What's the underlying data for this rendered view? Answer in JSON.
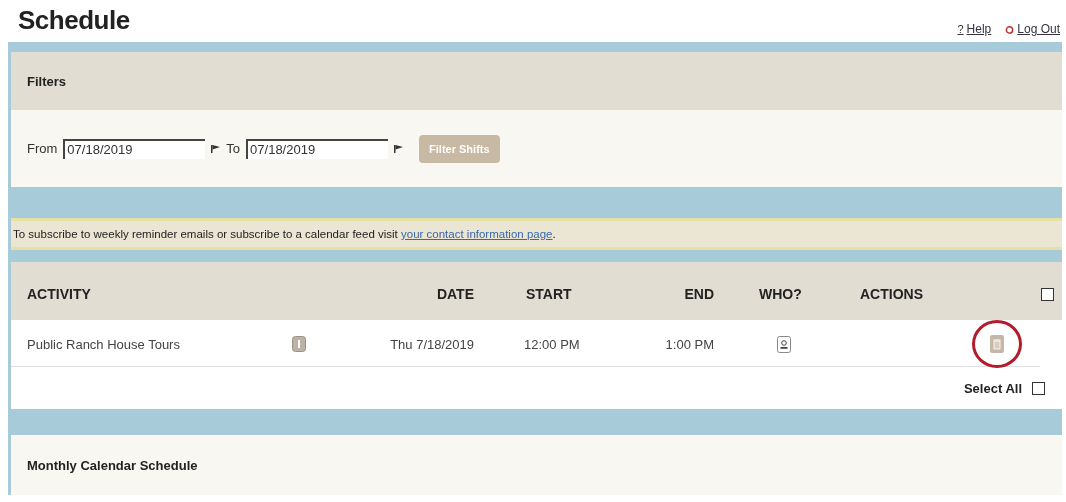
{
  "page": {
    "title": "Schedule"
  },
  "header_links": [
    {
      "kind": "help",
      "icon": "?",
      "label": "Help"
    },
    {
      "kind": "logout",
      "label": "Log Out"
    }
  ],
  "filters": {
    "title": "Filters",
    "from_label": "From",
    "from_value": "07/18/2019",
    "to_label": "To",
    "to_value": "07/18/2019",
    "button": "Filter Shifts",
    "button_disabled": true
  },
  "notice": {
    "text": "To subscribe to weekly reminder emails or subscribe to a calendar feed visit ",
    "link": "your contact information page",
    "end": "."
  },
  "table": {
    "columns": [
      "ACTIVITY",
      "DATE",
      "START",
      "END",
      "WHO?",
      "ACTIONS"
    ],
    "header_checked": false,
    "rows": [
      {
        "activity": "Public Ranch House Tours",
        "date": "Thu 7/18/2019",
        "start": "12:00 PM",
        "end": "1:00 PM",
        "action_highlighted": true
      }
    ],
    "select_all": {
      "label": "Select All",
      "checked": false
    }
  },
  "monthly": {
    "title": "Monthly Calendar Schedule"
  }
}
